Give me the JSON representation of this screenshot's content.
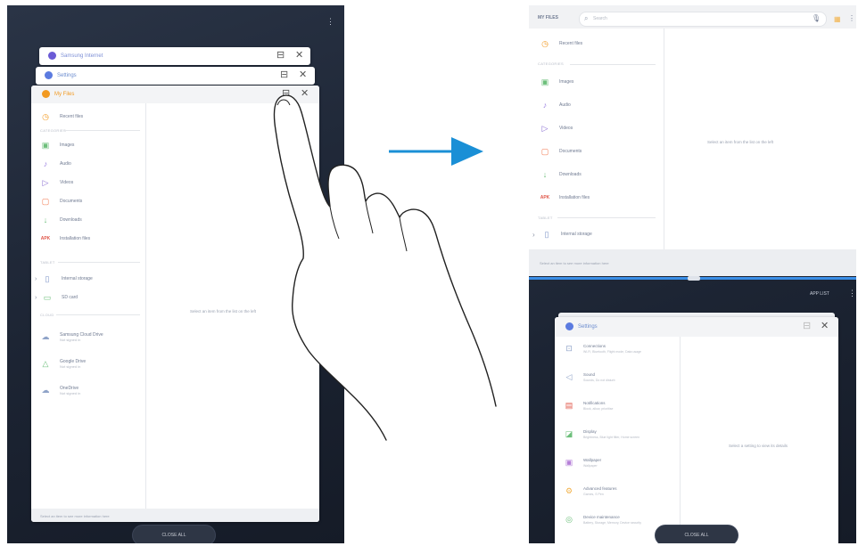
{
  "left_panel": {
    "cards": [
      {
        "title": "Samsung Internet",
        "icon": "samsung-internet-icon",
        "color": "#6b5bd6"
      },
      {
        "title": "Settings",
        "icon": "settings-app-icon",
        "color": "#5b7be0"
      },
      {
        "title": "My Files",
        "icon": "my-files-icon",
        "color": "#f29a22"
      }
    ],
    "my_files": {
      "recent": "Recent files",
      "categories_label": "CATEGORIES",
      "categories": [
        {
          "icon": "images-icon",
          "glyph": "▣",
          "label": "Images"
        },
        {
          "icon": "audio-icon",
          "glyph": "♪",
          "label": "Audio"
        },
        {
          "icon": "videos-icon",
          "glyph": "▷",
          "label": "Videos"
        },
        {
          "icon": "documents-icon",
          "glyph": "▢",
          "label": "Documents"
        },
        {
          "icon": "downloads-icon",
          "glyph": "↓",
          "label": "Downloads"
        },
        {
          "icon": "apk-icon",
          "glyph": "APK",
          "label": "Installation files"
        }
      ],
      "phone_label": "TABLET",
      "storage": [
        {
          "icon": "internal-storage-icon",
          "glyph": "▯",
          "label": "Internal storage"
        },
        {
          "icon": "sd-card-icon",
          "glyph": "▭",
          "label": "SD card"
        }
      ],
      "cloud_label": "CLOUD",
      "cloud": [
        {
          "icon": "samsung-cloud-icon",
          "glyph": "☁",
          "label": "Samsung Cloud Drive",
          "sub": "Not signed in"
        },
        {
          "icon": "google-drive-icon",
          "glyph": "△",
          "label": "Google Drive",
          "sub": "Not signed in"
        },
        {
          "icon": "onedrive-icon",
          "glyph": "☁",
          "label": "OneDrive",
          "sub": "Not signed in"
        }
      ],
      "empty_message": "Select an item from the list on the left",
      "footer": "Select an item to see more information here"
    },
    "close_all": "CLOSE ALL"
  },
  "right_panel": {
    "top_app": {
      "title": "MY FILES",
      "search_placeholder": "Search",
      "recent": "Recent files",
      "categories_label": "CATEGORIES",
      "categories": [
        {
          "icon": "images-icon",
          "glyph": "▣",
          "label": "Images"
        },
        {
          "icon": "audio-icon",
          "glyph": "♪",
          "label": "Audio"
        },
        {
          "icon": "videos-icon",
          "glyph": "▷",
          "label": "Videos"
        },
        {
          "icon": "documents-icon",
          "glyph": "▢",
          "label": "Documents"
        },
        {
          "icon": "downloads-icon",
          "glyph": "↓",
          "label": "Downloads"
        },
        {
          "icon": "apk-icon",
          "glyph": "APK",
          "label": "Installation files"
        }
      ],
      "phone_label": "TABLET",
      "storage": [
        {
          "icon": "internal-storage-icon",
          "glyph": "▯",
          "label": "Internal storage"
        }
      ],
      "empty_message": "Select an item from the list on the left",
      "footer": "Select an item to see more information here"
    },
    "bottom": {
      "app_list": "APP LIST",
      "settings_title": "Settings",
      "settings_items": [
        {
          "icon": "connections-icon",
          "glyph": "⊡",
          "title": "Connections",
          "sub": "Wi-Fi, Bluetooth, Flight mode, Data usage"
        },
        {
          "icon": "sound-icon",
          "glyph": "◁",
          "title": "Sound",
          "sub": "Sounds, Do not disturb"
        },
        {
          "icon": "notifications-icon",
          "glyph": "▤",
          "title": "Notifications",
          "sub": "Block, allow, prioritise"
        },
        {
          "icon": "display-icon",
          "glyph": "◪",
          "title": "Display",
          "sub": "Brightness, Blue light filter, Home screen"
        },
        {
          "icon": "wallpaper-icon",
          "glyph": "▣",
          "title": "Wallpaper",
          "sub": "Wallpaper"
        },
        {
          "icon": "advanced-features-icon",
          "glyph": "⚙",
          "title": "Advanced features",
          "sub": "Games, S Pen"
        },
        {
          "icon": "device-maintenance-icon",
          "glyph": "◎",
          "title": "Device maintenance",
          "sub": "Battery, Storage, Memory, Device security"
        }
      ],
      "empty_message": "Select a setting to view its details",
      "close_all": "CLOSE ALL"
    }
  },
  "colors": {
    "arrow": "#1a8fd6",
    "tablet_bg": "#1f2737",
    "accent_blue": "#3a8ee6"
  }
}
